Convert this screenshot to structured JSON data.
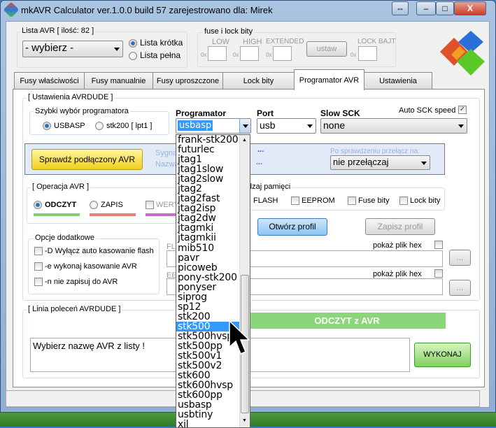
{
  "window": {
    "title": "mkAVR Calculator ver.1.0.0 build 57  zarejestrowano dla: Mirek",
    "btn_swap": "⇔",
    "btn_min": "–",
    "btn_max": "□",
    "btn_close": "X"
  },
  "avr_list": {
    "legend": "Lista AVR [ ilość: 82 ]",
    "combo": "- wybierz -",
    "radio_short": "Lista krótka",
    "radio_full": "Lista pełna"
  },
  "fuse": {
    "legend": "fuse i lock bity",
    "low": "LOW",
    "high": "HIGH",
    "extended": "EXTENDED",
    "lock": "LOCK BAJT",
    "prefix": "0x",
    "set": "ustaw"
  },
  "tabs": [
    "Fusy właściwości",
    "Fusy manualnie",
    "Fusy uproszczone",
    "Lock bity",
    "Programator AVR",
    "Ustawienia"
  ],
  "avrdude": {
    "legend": "[ Ustawienia AVRDUDE ]",
    "quick_legend": "Szybki wybór programatora",
    "quick_usbasp": "USBASP",
    "quick_stk200": "stk200 [ lpt1 ]",
    "prog_label": "Programator",
    "prog_value": "usbasp",
    "port_label": "Port",
    "port_value": "usb",
    "sck_label": "Slow SCK",
    "sck_value": "none",
    "auto_sck": "Auto SCK speed"
  },
  "check": {
    "button": "Sprawdź podłączony AVR",
    "sygn": "Sygna",
    "nazwa": "Nazwa",
    "dots1": "...",
    "dots2": "...",
    "after_label": "Po sprawdzeniu przełącz na:",
    "after_value": "nie przełączaj"
  },
  "operation": {
    "legend": "[ Operacja AVR ]",
    "read": "ODCZYT",
    "write": "ZAPIS",
    "verify": "WERY"
  },
  "memory": {
    "legend": "dzaj pamięci",
    "flash": "FLASH",
    "eeprom": "EEPROM",
    "fuse": "Fuse bity",
    "lock": "Lock bity"
  },
  "profile": {
    "open": "Otwórz profil",
    "save": "Zapisz profil"
  },
  "options": {
    "legend": "Opcje dodatkowe",
    "o1": "-D Wyłącz auto kasowanie flash",
    "o2": "-e wykonaj kasowanie AVR",
    "o3": "-n nie zapisuj do AVR"
  },
  "files": {
    "fl": "FL",
    "ee": "EE",
    "show_hex": "pokaż plik hex",
    "browse": "..."
  },
  "cmdline": {
    "legend": "[ Linia poleceń AVRDUDE ]",
    "status": "ODCZYT z AVR",
    "text": "Wybierz nazwę AVR z listy !",
    "run": "WYKONAJ"
  },
  "dropdown": {
    "items": [
      "frank-stk200",
      "futurlec",
      "jtag1",
      "jtag1slow",
      "jtag2slow",
      "jtag2",
      "jtag2fast",
      "jtag2isp",
      "jtag2dw",
      "jtagmki",
      "jtagmkii",
      "mib510",
      "pavr",
      "picoweb",
      "pony-stk200",
      "ponyser",
      "siprog",
      "sp12",
      "stk200",
      "stk500",
      "stk500hvsp",
      "stk500pp",
      "stk500v1",
      "stk500v2",
      "stk600",
      "stk600hvsp",
      "stk600pp",
      "usbasp",
      "usbtiny",
      "xil"
    ],
    "selected": "stk500"
  },
  "colors": {
    "read": "#7fd26a",
    "write": "#e0846a",
    "verify": "#c86ad2",
    "status_bar": "#8bd67a"
  }
}
